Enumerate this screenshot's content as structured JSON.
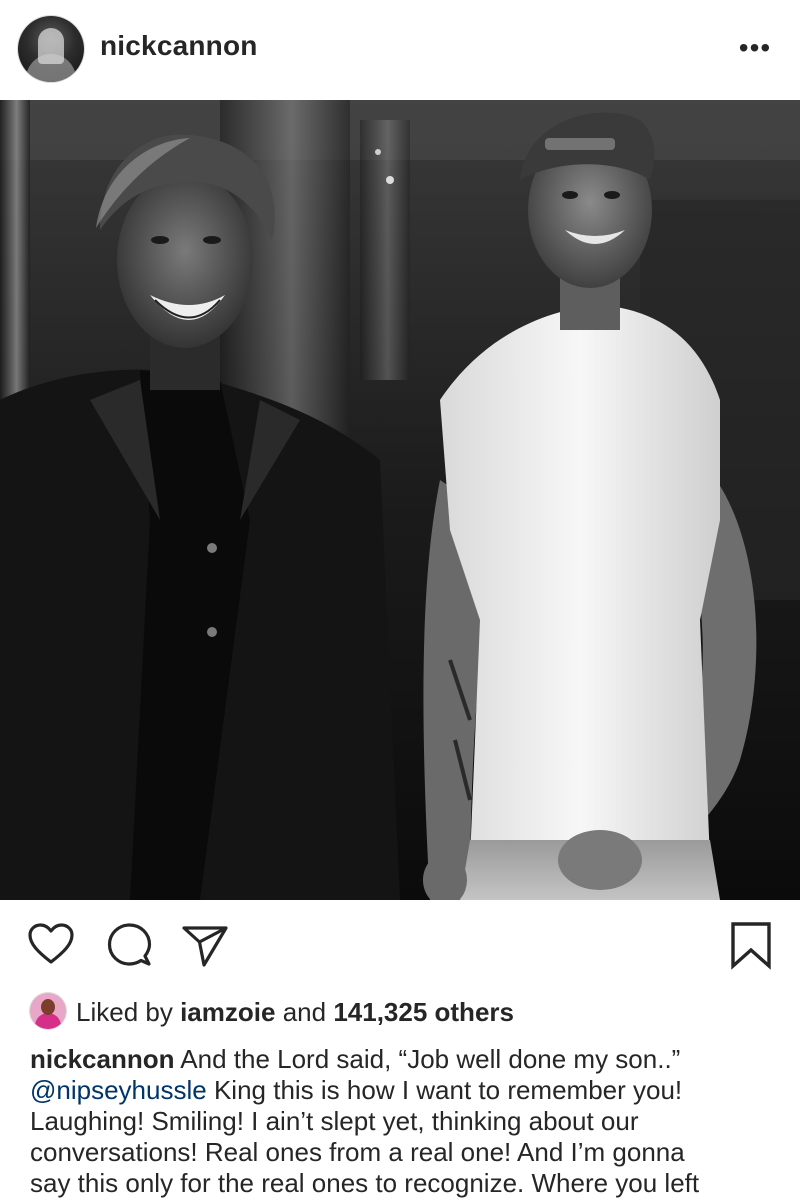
{
  "post": {
    "username": "nickcannon",
    "more_label": "•••",
    "photo_alt": "",
    "likes": {
      "prefix": "Liked by",
      "liker": "iamzoie",
      "connector": "and",
      "count": "141,325 others"
    },
    "caption": {
      "username": "nickcannon",
      "line1_rest": "And the Lord said, “Job well done my son..”",
      "mention": "@nipseyhussle",
      "line2_rest": "King this is how I want to remember you!",
      "line3": "Laughing! Smiling! I ain’t slept yet, thinking about our",
      "line4": "conversations! Real ones from a real one! And I’m gonna",
      "line5": "say this only for the real ones to recognize. Where you left"
    }
  },
  "icons": {
    "more": "more-options-icon",
    "like": "heart-icon",
    "comment": "comment-icon",
    "share": "paper-plane-icon",
    "save": "bookmark-icon"
  },
  "colors": {
    "text": "#262626",
    "mention": "#003569",
    "background": "#ffffff"
  }
}
